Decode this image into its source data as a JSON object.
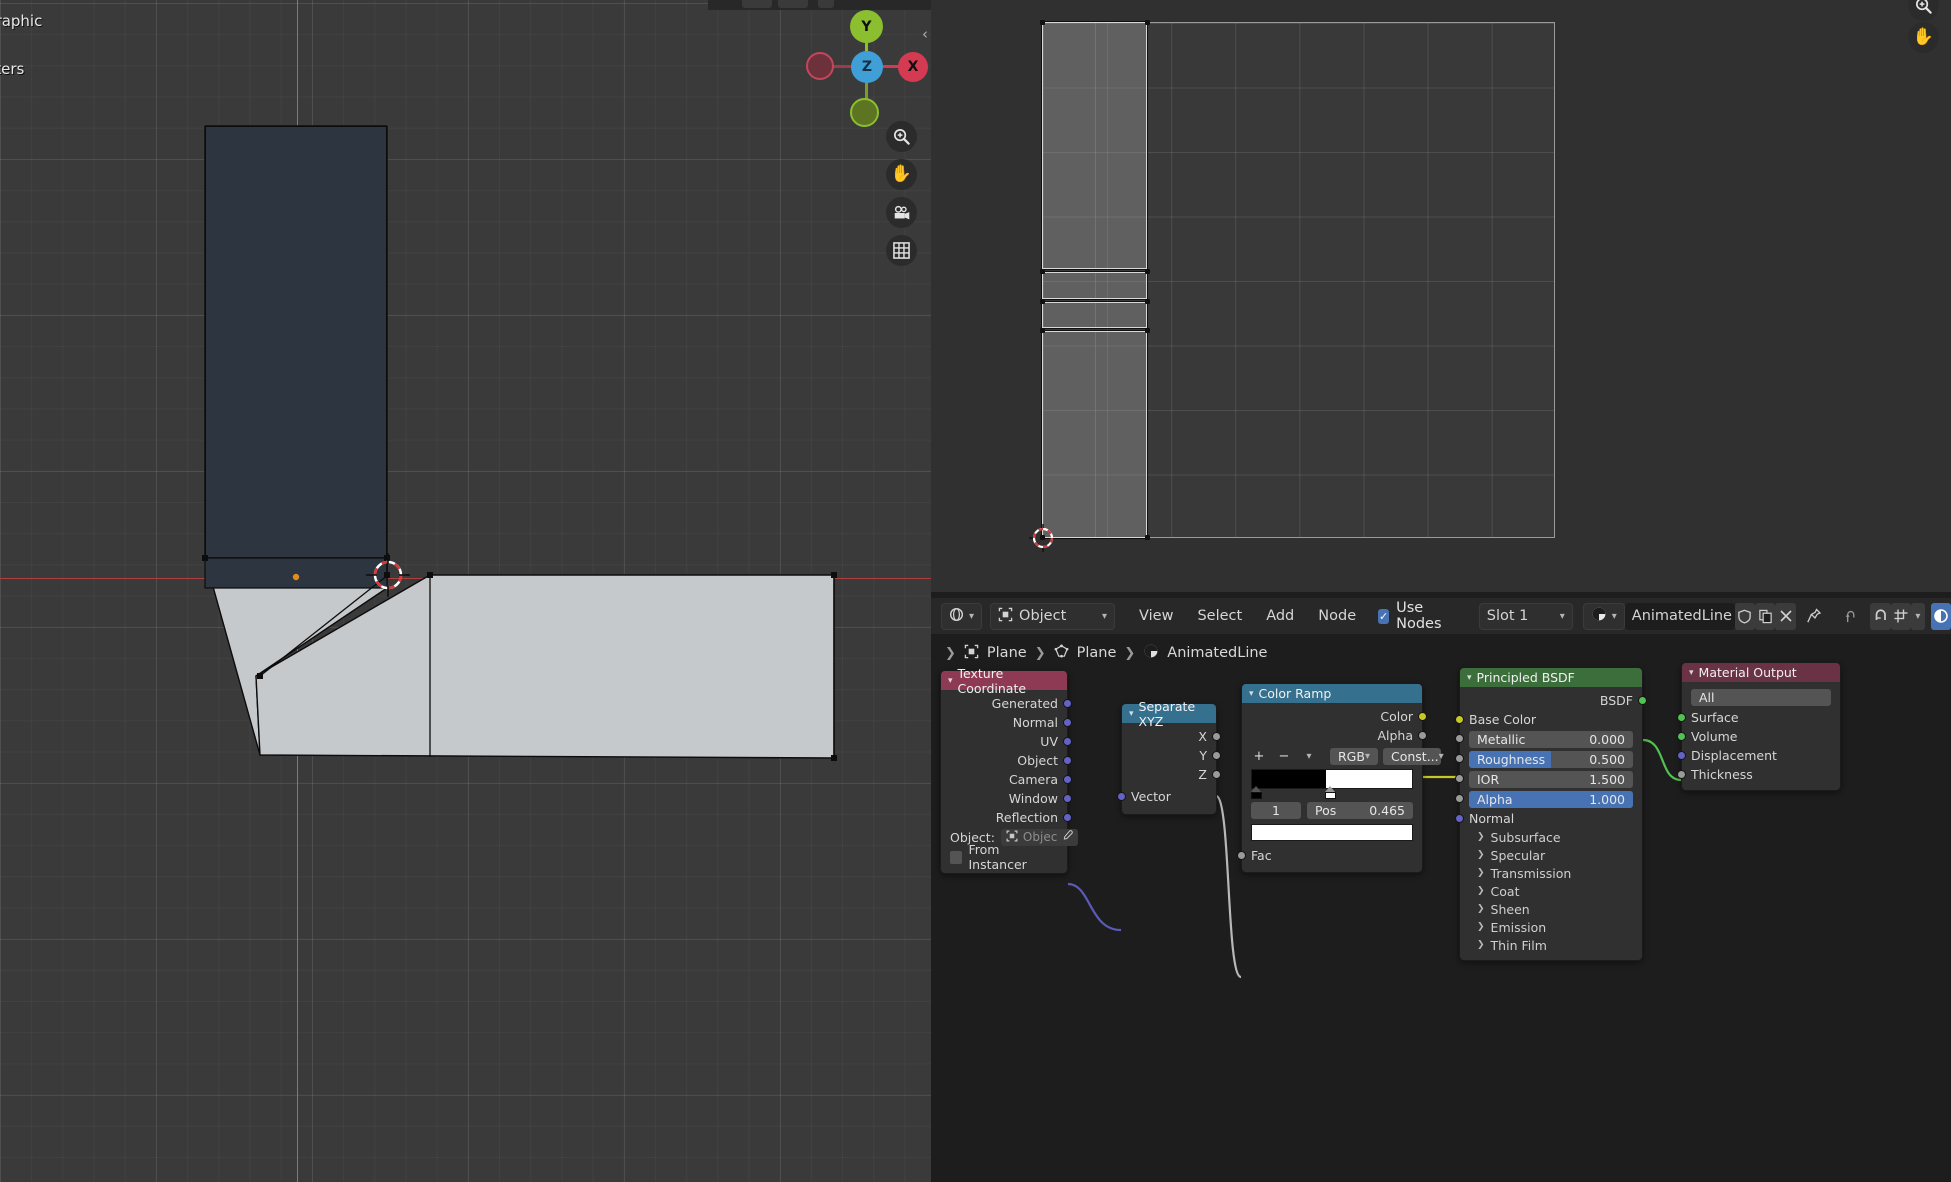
{
  "viewport": {
    "perspective_label": "graphic",
    "units_label": "eters",
    "gizmo": {
      "y": "Y",
      "z": "Z",
      "x": "X"
    },
    "tools": [
      "zoom-icon",
      "hand-pan-icon",
      "camera-view-icon",
      "grid-toggle-icon"
    ]
  },
  "uv_editor": {
    "tools": [
      "zoom-icon",
      "hand-pan-icon"
    ]
  },
  "header": {
    "editor_type_icon": "shader-editor-icon",
    "shader_type": "Object",
    "menus": [
      "View",
      "Select",
      "Add",
      "Node"
    ],
    "use_nodes_label": "Use Nodes",
    "use_nodes_checked": true,
    "slot": "Slot 1",
    "material_icon": "material-sphere-icon",
    "material_name": "AnimatedLine",
    "shield_icon": "fake-user-icon",
    "copy_icon": "new-material-icon",
    "close_icon": "unlink-icon",
    "pin_icon": "pin-icon",
    "up_icon": "go-parent-icon",
    "snap_icon": "snap-magnet-icon",
    "snap_to_icon": "snap-target-icon",
    "overlay_icon": "overlays-icon"
  },
  "breadcrumb": [
    {
      "icon": "object-icon",
      "label": "Plane"
    },
    {
      "icon": "mesh-data-icon",
      "label": "Plane"
    },
    {
      "icon": "material-icon",
      "label": "AnimatedLine"
    }
  ],
  "nodes": {
    "texture_coordinate": {
      "title": "Texture Coordinate",
      "header_color": "#8e3a55",
      "outputs": [
        "Generated",
        "Normal",
        "UV",
        "Object",
        "Camera",
        "Window",
        "Reflection"
      ],
      "object_label": "Object:",
      "object_value": "Objec",
      "from_instancer_label": "From Instancer"
    },
    "separate_xyz": {
      "title": "Separate XYZ",
      "header_color": "#35708f",
      "outputs": [
        "X",
        "Y",
        "Z"
      ],
      "inputs": [
        "Vector"
      ]
    },
    "color_ramp": {
      "title": "Color Ramp",
      "header_color": "#35708f",
      "outputs": [
        "Color",
        "Alpha"
      ],
      "inputs": [
        "Fac"
      ],
      "buttons": {
        "add": "+",
        "remove": "−",
        "menu": "v"
      },
      "color_mode": "RGB",
      "interpolation": "Const...",
      "active_index": "1",
      "pos_label": "Pos",
      "pos_value": "0.465",
      "stops": [
        {
          "position": 0.0,
          "color": "#000000"
        },
        {
          "position": 0.465,
          "color": "#ffffff"
        }
      ],
      "selected_color": "#ffffff"
    },
    "principled_bsdf": {
      "title": "Principled BSDF",
      "header_color": "#3b6e3b",
      "outputs": [
        "BSDF"
      ],
      "base_color_label": "Base Color",
      "sliders": [
        {
          "label": "Metallic",
          "value": "0.000",
          "fill": 0.0
        },
        {
          "label": "Roughness",
          "value": "0.500",
          "fill": 0.5
        },
        {
          "label": "IOR",
          "value": "1.500",
          "fill": 0.0
        },
        {
          "label": "Alpha",
          "value": "1.000",
          "fill": 1.0
        }
      ],
      "normal_label": "Normal",
      "panels": [
        "Subsurface",
        "Specular",
        "Transmission",
        "Coat",
        "Sheen",
        "Emission",
        "Thin Film"
      ]
    },
    "material_output": {
      "title": "Material Output",
      "header_color": "#6a3245",
      "target": "All",
      "inputs": [
        "Surface",
        "Volume",
        "Displacement",
        "Thickness"
      ]
    }
  },
  "colors": {
    "accent_blue": "#4772b3",
    "socket_vector": "#6363c7",
    "socket_color": "#c7c729",
    "socket_gray": "#9a9a9a",
    "socket_shader": "#52c152",
    "axis_x_red": "#ac4040",
    "axis_y_green": "#5c9a35"
  }
}
